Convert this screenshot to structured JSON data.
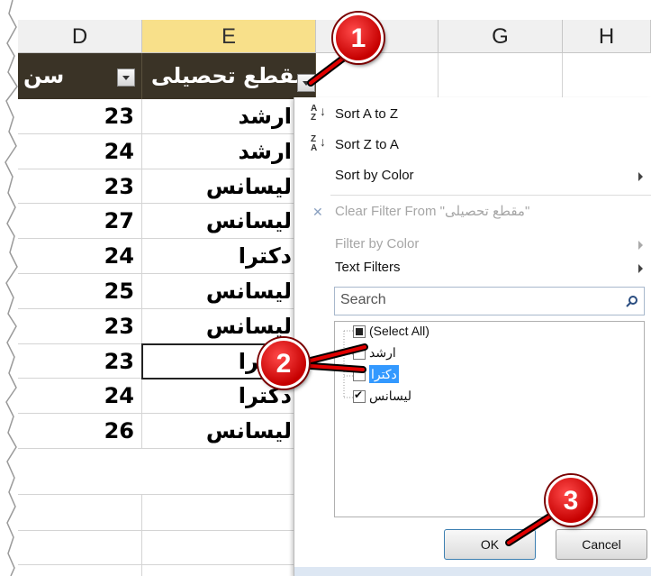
{
  "columns": {
    "d": "D",
    "e": "E",
    "f": "",
    "g": "G",
    "h": "H"
  },
  "header_row": {
    "d_label": "سن",
    "e_label": "مقطع تحصیلی"
  },
  "rows": [
    {
      "age": "23",
      "degree": "ارشد"
    },
    {
      "age": "24",
      "degree": "ارشد"
    },
    {
      "age": "23",
      "degree": "لیسانس"
    },
    {
      "age": "27",
      "degree": "لیسانس"
    },
    {
      "age": "24",
      "degree": "دکترا"
    },
    {
      "age": "25",
      "degree": "لیسانس"
    },
    {
      "age": "23",
      "degree": "لیسانس"
    },
    {
      "age": "23",
      "degree": "دکترا"
    },
    {
      "age": "24",
      "degree": "دکترا"
    },
    {
      "age": "26",
      "degree": "لیسانس"
    }
  ],
  "menu": {
    "sort_az": "Sort A to Z",
    "sort_za": "Sort Z to A",
    "sort_by_color": "Sort by Color",
    "clear_filter": "Clear Filter From \"مقطع تحصیلی\"",
    "filter_by_color": "Filter by Color",
    "text_filters": "Text Filters",
    "search_placeholder": "Search",
    "select_all": "(Select All)",
    "items": [
      {
        "label": "ارشد",
        "checked": false
      },
      {
        "label": "دکترا",
        "checked": false
      },
      {
        "label": "لیسانس",
        "checked": true
      }
    ],
    "ok": "OK",
    "cancel": "Cancel"
  },
  "callouts": [
    "1",
    "2",
    "3"
  ],
  "colors": {
    "header_fill": "#3a3326",
    "selected_column": "#f8e08a",
    "badge_red": "#d40000",
    "highlight": "#3399ff"
  }
}
